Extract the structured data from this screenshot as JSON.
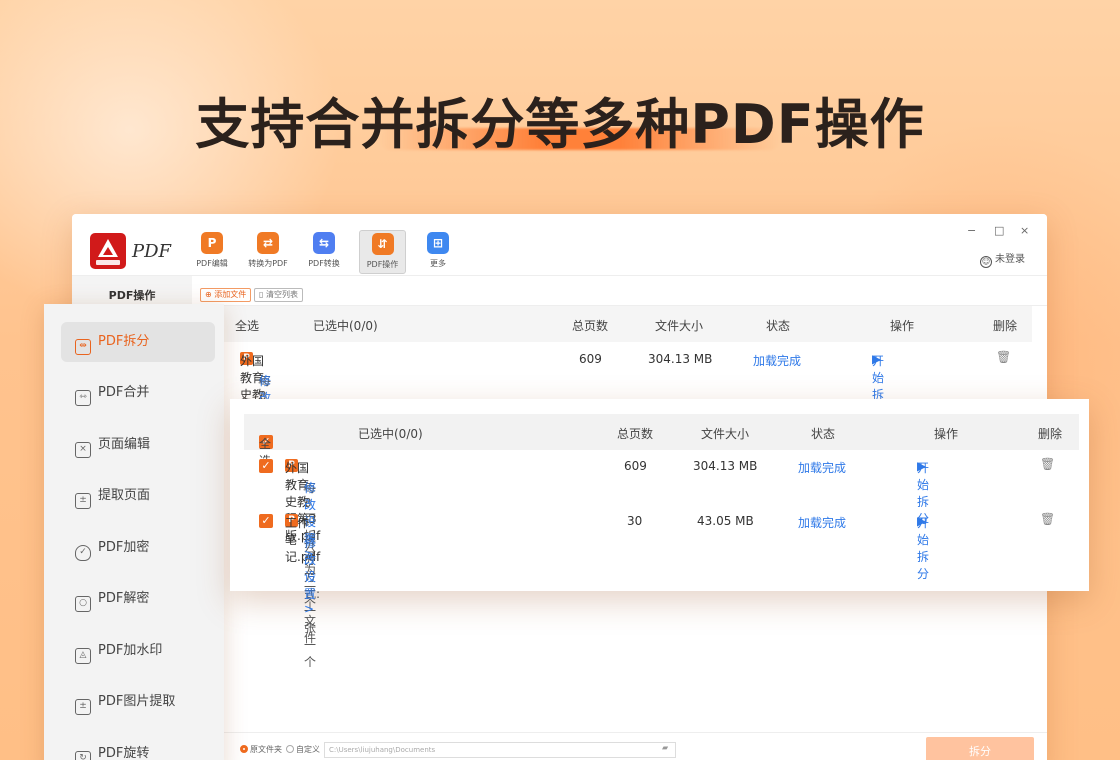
{
  "headline": "支持合并拆分等多种PDF操作",
  "colors": {
    "accent": "#ef6b1f",
    "link": "#2f79e8",
    "background": "#ffc38e"
  },
  "app": {
    "logo_text": "PDF",
    "toolbar": [
      {
        "label": "PDF编辑",
        "icon": "pdf-edit-icon",
        "color": "#f07a25"
      },
      {
        "label": "转换为PDF",
        "icon": "convert-to-pdf-icon",
        "color": "#f07a25"
      },
      {
        "label": "PDF转换",
        "icon": "pdf-convert-icon",
        "color": "#4f7ef1"
      },
      {
        "label": "PDF操作",
        "icon": "pdf-operation-icon",
        "color": "#f07a25"
      },
      {
        "label": "更多",
        "icon": "more-apps-icon",
        "color": "#3e88f0"
      }
    ],
    "window_controls": {
      "minimize": "−",
      "maximize": "□",
      "close": "×"
    },
    "user_label": "未登录",
    "sidebar_title": "PDF操作",
    "sub_buttons": {
      "add_file": "添加文件",
      "clear_list": "清空列表"
    },
    "table_headers": {
      "select_all": "全选",
      "selected": "已选中(0/0)",
      "pages": "总页数",
      "size": "文件大小",
      "status": "状态",
      "action": "操作",
      "delete": "删除"
    },
    "row": {
      "name": "外国教育史教程第3版.pdf",
      "sub": "每3页拆分为一个文件",
      "modify": "修改设置 >",
      "pages": "609",
      "size": "304.13 MB",
      "status": "加载完成",
      "action": "开始拆分"
    },
    "bottom": {
      "opt1": "原文件夹",
      "opt2": "自定义",
      "path": "C:\\Users\\liujuhang\\Documents",
      "split_button": "拆分"
    }
  },
  "sidebar": {
    "items": [
      {
        "label": "PDF拆分",
        "icon": "split-icon",
        "glyph": "⇹"
      },
      {
        "label": "PDF合并",
        "icon": "merge-icon",
        "glyph": "⇿"
      },
      {
        "label": "页面编辑",
        "icon": "page-edit-icon",
        "glyph": "×"
      },
      {
        "label": "提取页面",
        "icon": "extract-page-icon",
        "glyph": "±"
      },
      {
        "label": "PDF加密",
        "icon": "shield-icon",
        "glyph": "✓"
      },
      {
        "label": "PDF解密",
        "icon": "unlock-icon",
        "glyph": "○"
      },
      {
        "label": "PDF加水印",
        "icon": "watermark-icon",
        "glyph": "◬"
      },
      {
        "label": "PDF图片提取",
        "icon": "image-extract-icon",
        "glyph": "±"
      },
      {
        "label": "PDF旋转",
        "icon": "rotate-icon",
        "glyph": "↻"
      }
    ]
  },
  "zoom": {
    "headers": {
      "select_all": "全选",
      "selected": "已选中(0/0)",
      "pages": "总页数",
      "size": "文件大小",
      "status": "状态",
      "action": "操作",
      "delete": "删除"
    },
    "rows": [
      {
        "name": "外国教育史教程第3版.pdf",
        "sub": "每3页拆分为一个文件",
        "modify": "修改设置 >",
        "pages": "609",
        "size": "304.13 MB",
        "status": "加载完成",
        "action": "开始拆分"
      },
      {
        "name": "工作笔记.pdf",
        "sub": "拆分方式: 一张一个",
        "modify": "修改设置 >",
        "pages": "30",
        "size": "43.05 MB",
        "status": "加载完成",
        "action": "开始拆分"
      }
    ]
  }
}
